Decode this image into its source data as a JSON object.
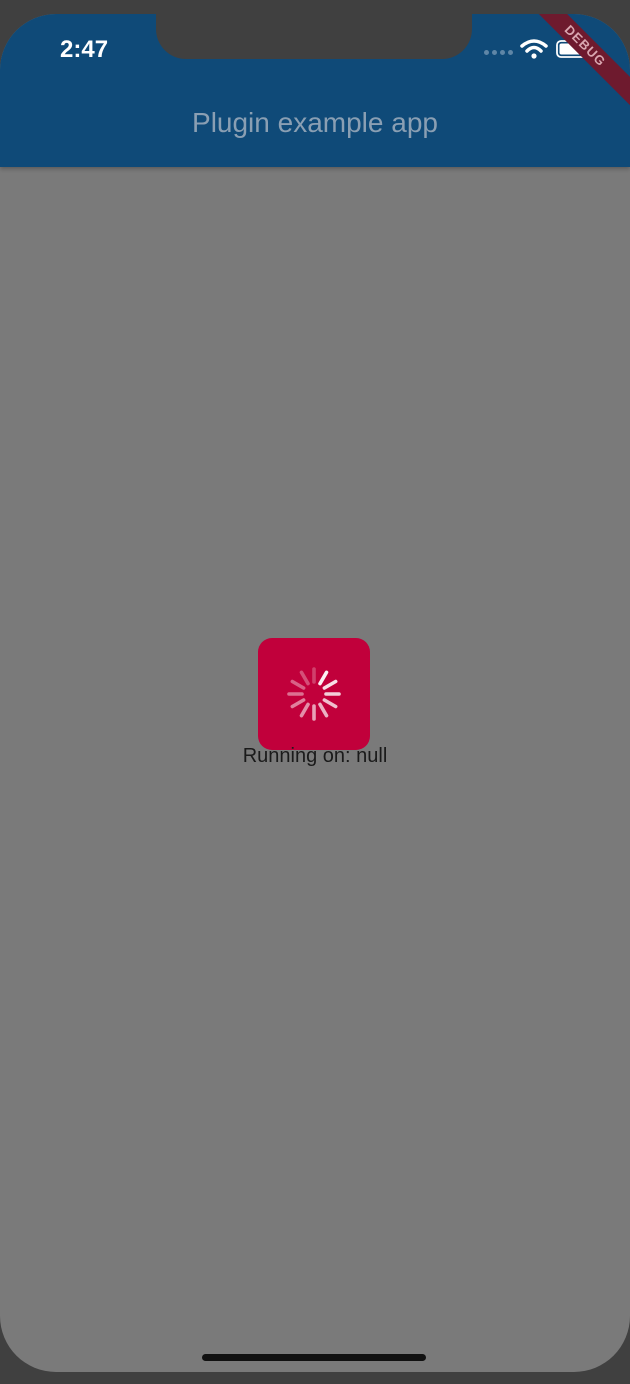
{
  "status_bar": {
    "time": "2:47"
  },
  "debug_banner": "DEBUG",
  "app_bar": {
    "title": "Plugin example app"
  },
  "loader": {
    "icon": "spinner-icon"
  },
  "content": {
    "running_text": "Running on: null"
  },
  "colors": {
    "app_bar": "#0f4a78",
    "background": "#7a7a7a",
    "loader": "#c1003b"
  }
}
